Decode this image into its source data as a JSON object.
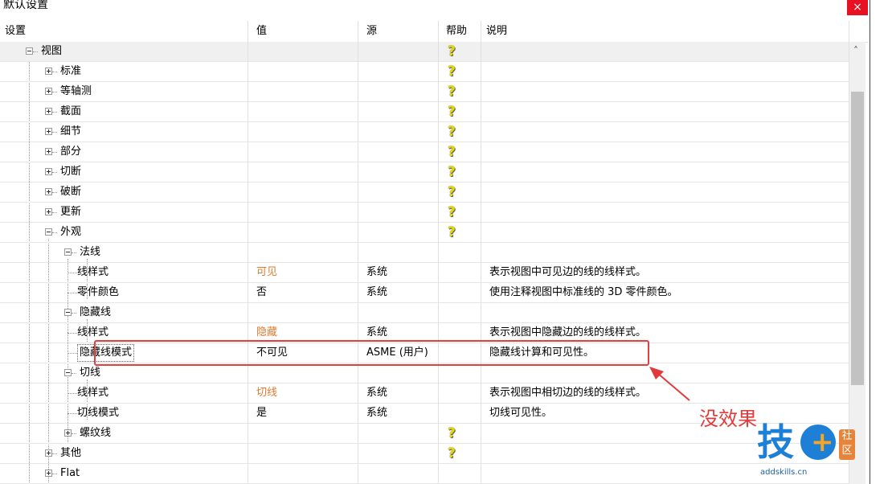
{
  "window": {
    "title": "默认设置",
    "close_glyph": "×"
  },
  "columns": {
    "setting": "设置",
    "value": "值",
    "source": "源",
    "help": "帮助",
    "description": "说明"
  },
  "rows": [
    {
      "label": "视图",
      "value": "",
      "source": "",
      "help": true,
      "desc": ""
    },
    {
      "label": "标准",
      "value": "",
      "source": "",
      "help": true,
      "desc": ""
    },
    {
      "label": "等轴测",
      "value": "",
      "source": "",
      "help": true,
      "desc": ""
    },
    {
      "label": "截面",
      "value": "",
      "source": "",
      "help": true,
      "desc": ""
    },
    {
      "label": "细节",
      "value": "",
      "source": "",
      "help": true,
      "desc": ""
    },
    {
      "label": "部分",
      "value": "",
      "source": "",
      "help": true,
      "desc": ""
    },
    {
      "label": "切断",
      "value": "",
      "source": "",
      "help": true,
      "desc": ""
    },
    {
      "label": "破断",
      "value": "",
      "source": "",
      "help": true,
      "desc": ""
    },
    {
      "label": "更新",
      "value": "",
      "source": "",
      "help": true,
      "desc": ""
    },
    {
      "label": "外观",
      "value": "",
      "source": "",
      "help": true,
      "desc": ""
    },
    {
      "label": "法线",
      "value": "",
      "source": "",
      "help": false,
      "desc": ""
    },
    {
      "label": "线样式",
      "value": "可见",
      "source": "系统",
      "help": false,
      "desc": "表示视图中可见边的线的线样式。"
    },
    {
      "label": "零件颜色",
      "value": "否",
      "source": "系统",
      "help": false,
      "desc": "使用注释视图中标准线的 3D 零件颜色。"
    },
    {
      "label": "隐藏线",
      "value": "",
      "source": "",
      "help": false,
      "desc": ""
    },
    {
      "label": "线样式",
      "value": "隐藏",
      "source": "系统",
      "help": false,
      "desc": "表示视图中隐藏边的线的线样式。"
    },
    {
      "label": "隐藏线模式",
      "value": "不可见",
      "source": "ASME (用户)",
      "help": false,
      "desc": "隐藏线计算和可见性。"
    },
    {
      "label": "切线",
      "value": "",
      "source": "",
      "help": false,
      "desc": ""
    },
    {
      "label": "线样式",
      "value": "切线",
      "source": "系统",
      "help": false,
      "desc": "表示视图中相切边的线的线样式。"
    },
    {
      "label": "切线模式",
      "value": "是",
      "source": "系统",
      "help": false,
      "desc": "切线可见性。"
    },
    {
      "label": "螺纹线",
      "value": "",
      "source": "",
      "help": true,
      "desc": ""
    },
    {
      "label": "其他",
      "value": "",
      "source": "",
      "help": true,
      "desc": ""
    },
    {
      "label": "Flat",
      "value": "",
      "source": "",
      "help": false,
      "desc": ""
    }
  ],
  "help_glyph": "?",
  "scroll_up_glyph": "˄",
  "annotation": {
    "text": "没效果"
  },
  "watermark": {
    "char": "技",
    "plus": "+",
    "badge": "社区",
    "url": "addskills.cn"
  }
}
